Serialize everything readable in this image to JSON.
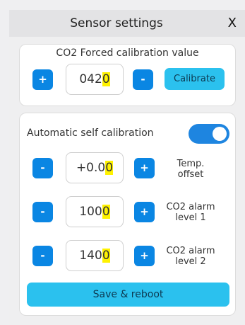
{
  "window": {
    "title": "Sensor settings",
    "close_label": "X"
  },
  "forced_calibration": {
    "label": "CO2 Forced calibration value",
    "increment_label": "+",
    "value_prefix": "042",
    "value_cursor": "0",
    "decrement_label": "-",
    "calibrate_label": "Calibrate"
  },
  "asc": {
    "label": "Automatic self calibration",
    "enabled": true
  },
  "rows": [
    {
      "minus": "-",
      "value_prefix": "+0.0",
      "value_cursor": "0",
      "plus": "+",
      "label_line1": "Temp.",
      "label_line2": "offset"
    },
    {
      "minus": "-",
      "value_prefix": "100",
      "value_cursor": "0",
      "plus": "+",
      "label_line1": "CO2 alarm",
      "label_line2": "level 1"
    },
    {
      "minus": "-",
      "value_prefix": "140",
      "value_cursor": "0",
      "plus": "+",
      "label_line1": "CO2 alarm",
      "label_line2": "level 2"
    }
  ],
  "save_label": "Save & reboot",
  "colors": {
    "primary_button": "#0a86e3",
    "accent_button": "#2bc1ee",
    "cursor_highlight": "#fff200",
    "toggle_on": "#1e85e0"
  }
}
